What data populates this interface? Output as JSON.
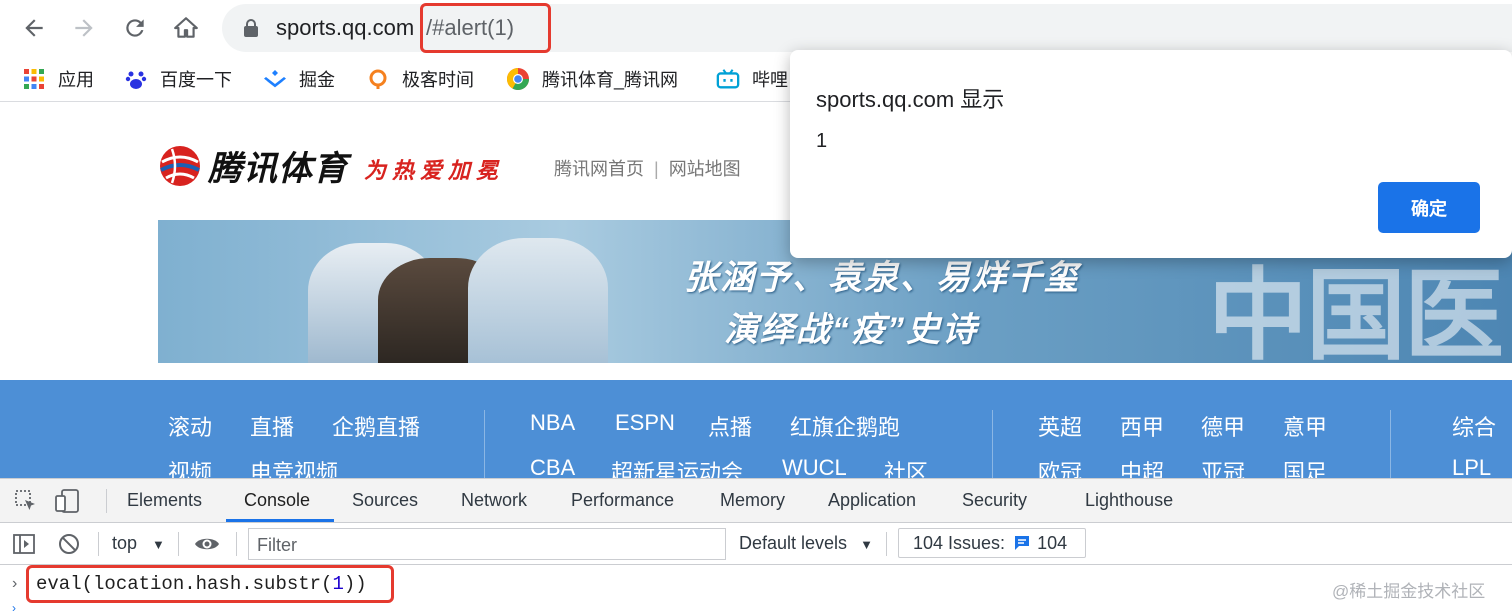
{
  "browser": {
    "url_host": "sports.qq.com",
    "url_hash": "/#alert(1)",
    "bookmarks": [
      {
        "label": "应用",
        "icon": "apps-grid-icon"
      },
      {
        "label": "百度一下",
        "icon": "baidu-paw-icon"
      },
      {
        "label": "掘金",
        "icon": "juejin-icon"
      },
      {
        "label": "极客时间",
        "icon": "geektime-icon"
      },
      {
        "label": "腾讯体育_腾讯网",
        "icon": "chrome-like-icon"
      },
      {
        "label": "哔哩",
        "icon": "bilibili-tv-icon"
      }
    ]
  },
  "page": {
    "logo_text": "腾讯体育",
    "slogan": "为热爱加冕",
    "top_links": [
      "腾讯网首页",
      "网站地图"
    ],
    "top_links_sep": "|",
    "banner_line1": "张涵予、袁泉、易烊千玺",
    "banner_line2": "演绎战“疫”史诗",
    "banner_big": "中国医生",
    "nav": {
      "row1": [
        "滚动",
        "直播",
        "企鹅直播",
        "NBA",
        "ESPN",
        "点播",
        "红旗企鹅跑",
        "英超",
        "西甲",
        "德甲",
        "意甲",
        "综合"
      ],
      "row2": [
        "视频",
        "电竞视频",
        "CBA",
        "超新星运动会",
        "WUCL",
        "社区",
        "欧冠",
        "中超",
        "亚冠",
        "国足",
        "LPL"
      ]
    }
  },
  "alert": {
    "title": "sports.qq.com 显示",
    "message": "1",
    "ok_label": "确定"
  },
  "devtools": {
    "tabs": [
      "Elements",
      "Console",
      "Sources",
      "Network",
      "Performance",
      "Memory",
      "Application",
      "Security",
      "Lighthouse"
    ],
    "active_tab": "Console",
    "context": "top",
    "filter_placeholder": "Filter",
    "levels_label": "Default levels",
    "issues_label": "104 Issues:",
    "issues_count": "104",
    "console_prefix": "eval(location.hash.substr(",
    "console_arg": "1",
    "console_suffix": "))",
    "watermark": "@稀土掘金技术社区"
  },
  "colors": {
    "accent": "#1a73e8",
    "highlight_box": "#e53a2f",
    "nav_bar": "#4d8fd6",
    "slogan_red": "#d8231f"
  }
}
